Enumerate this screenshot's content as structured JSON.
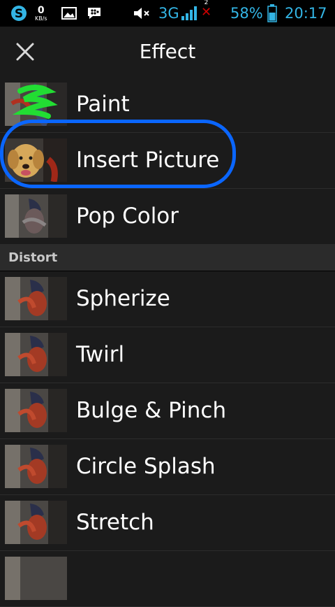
{
  "status_bar": {
    "kb_value": "0",
    "kb_unit": "KB/s",
    "network": "3G",
    "notification_count": "2",
    "battery": "58%",
    "time": "20:17",
    "icons": [
      "skype-icon",
      "gallery-icon",
      "bbm-icon",
      "mute-icon",
      "signal-icon",
      "no-sim-icon",
      "battery-icon"
    ]
  },
  "header": {
    "title": "Effect",
    "close_icon": "close-icon"
  },
  "items_top": [
    {
      "label": "Paint",
      "thumb": "paint-thumbnail"
    },
    {
      "label": "Insert Picture",
      "thumb": "dog-thumbnail"
    },
    {
      "label": "Pop Color",
      "thumb": "photo-thumbnail"
    }
  ],
  "section": {
    "label": "Distort"
  },
  "items_distort": [
    {
      "label": "Spherize"
    },
    {
      "label": "Twirl"
    },
    {
      "label": "Bulge & Pinch"
    },
    {
      "label": "Circle Splash"
    },
    {
      "label": "Stretch"
    }
  ],
  "colors": {
    "accent": "#33b5e5",
    "highlight_annotation": "#0a66ff",
    "background": "#1b1b1b"
  }
}
